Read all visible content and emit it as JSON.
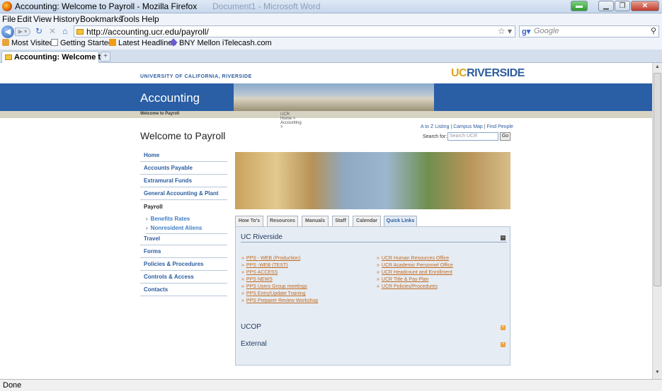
{
  "window": {
    "title": "Accounting: Welcome to Payroll - Mozilla Firefox",
    "background_title": "Document1 - Microsoft Word"
  },
  "menu": [
    "File",
    "Edit",
    "View",
    "History",
    "Bookmarks",
    "Tools",
    "Help"
  ],
  "nav": {
    "url": "http://accounting.ucr.edu/payroll/",
    "search_placeholder": "Google"
  },
  "bookmarks": [
    "Most Visited",
    "Getting Started",
    "Latest Headlines",
    "BNY Mellon iTelecash.com"
  ],
  "tab": {
    "label": "Accounting: Welcome t..."
  },
  "status": "Done",
  "site": {
    "university": "UNIVERSITY OF CALIFORNIA, RIVERSIDE",
    "logo_uc": "UC",
    "logo_riverside": "RIVERSIDE",
    "banner_title": "Accounting",
    "breadcrumb_prefix": "UCR Home > Accounting > ",
    "breadcrumb_current": "Welcome to Payroll",
    "page_title": "Welcome to Payroll",
    "top_links": {
      "az": "A to Z Listing",
      "sep1": " | ",
      "map": "Campus Map",
      "sep2": " | ",
      "people": "Find People"
    },
    "search_label": "Search for:",
    "search_placeholder": "Search UCR",
    "go": "Go"
  },
  "left_nav": {
    "items": [
      "Home",
      "Accounts Payable",
      "Extramural Funds",
      "General Accounting & Plant",
      "Payroll",
      "Travel",
      "Forms",
      "Policies & Procedures",
      "Controls & Access",
      "Contacts"
    ],
    "payroll_sub": [
      "Benefits Rates",
      "Nonresident Aliens"
    ]
  },
  "content_tabs": [
    "How To's",
    "Resources",
    "Manuals",
    "Staff",
    "Calendar",
    "Quick Links"
  ],
  "active_tab": "Quick Links",
  "sections": {
    "ucr": "UC Riverside",
    "ucop": "UCOP",
    "external": "External"
  },
  "links_left": [
    "PPS - WEB (Production)",
    "PPS -WEB (TEST)",
    "PPS ACCESS",
    "PPS NEWS",
    "PPS Users Group meetings",
    "PPS Entry/Update Training",
    "PPS Preparer Review Workshop"
  ],
  "links_right": [
    "UCR Human Resources Office",
    "UCR Academic Personnel Office",
    "UCR Headcount and Enrollment",
    "UCR Title & Pay Plan",
    "UCR Policies/Procedures"
  ],
  "colors": {
    "brand_blue": "#2a5ea5",
    "link_orange": "#c06a20",
    "accent_gold": "#d9a520"
  }
}
